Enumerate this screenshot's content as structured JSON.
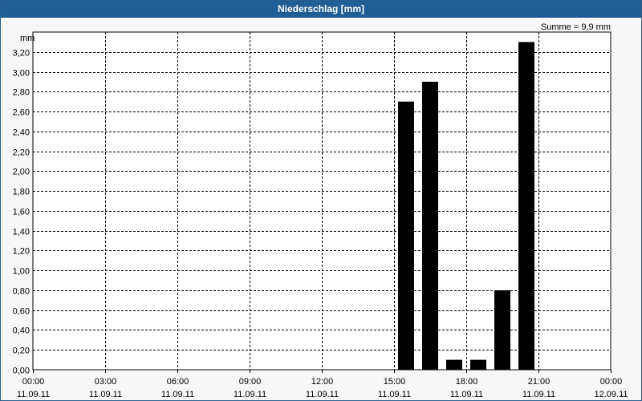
{
  "window": {
    "title": "Niederschlag [mm]"
  },
  "colors": {
    "titlebar": "#1f5f96",
    "bar": "#000000",
    "background": "#f7f7f7",
    "grid": "#000000"
  },
  "chart_data": {
    "type": "bar",
    "title": "Niederschlag [mm]",
    "ylabel": "mm",
    "xlabel": "",
    "summary": "Summe = 9,9 mm",
    "ylim": [
      0,
      3.4
    ],
    "y_ticks": [
      0,
      0.2,
      0.4,
      0.6,
      0.8,
      1.0,
      1.2,
      1.4,
      1.6,
      1.8,
      2.0,
      2.2,
      2.4,
      2.6,
      2.8,
      3.0,
      3.2
    ],
    "y_tick_labels": [
      "0,00",
      "0,20",
      "0,40",
      "0,60",
      "0,80",
      "1,00",
      "1,20",
      "1,40",
      "1,60",
      "1,80",
      "2,00",
      "2,20",
      "2,40",
      "2,60",
      "2,80",
      "3,00",
      "3,20"
    ],
    "x_ticks": [
      {
        "time": "00:00",
        "date": "11.09.11"
      },
      {
        "time": "03:00",
        "date": "11.09.11"
      },
      {
        "time": "06:00",
        "date": "11.09.11"
      },
      {
        "time": "09:00",
        "date": "11.09.11"
      },
      {
        "time": "12:00",
        "date": "11.09.11"
      },
      {
        "time": "15:00",
        "date": "11.09.11"
      },
      {
        "time": "18:00",
        "date": "11.09.11"
      },
      {
        "time": "21:00",
        "date": "11.09.11"
      },
      {
        "time": "00:00",
        "date": "12.09.11"
      }
    ],
    "categories": [
      "15:00",
      "16:00",
      "17:00",
      "18:00",
      "19:00",
      "20:00"
    ],
    "values": [
      2.7,
      2.9,
      0.1,
      0.1,
      0.8,
      3.3
    ],
    "grid": true
  }
}
